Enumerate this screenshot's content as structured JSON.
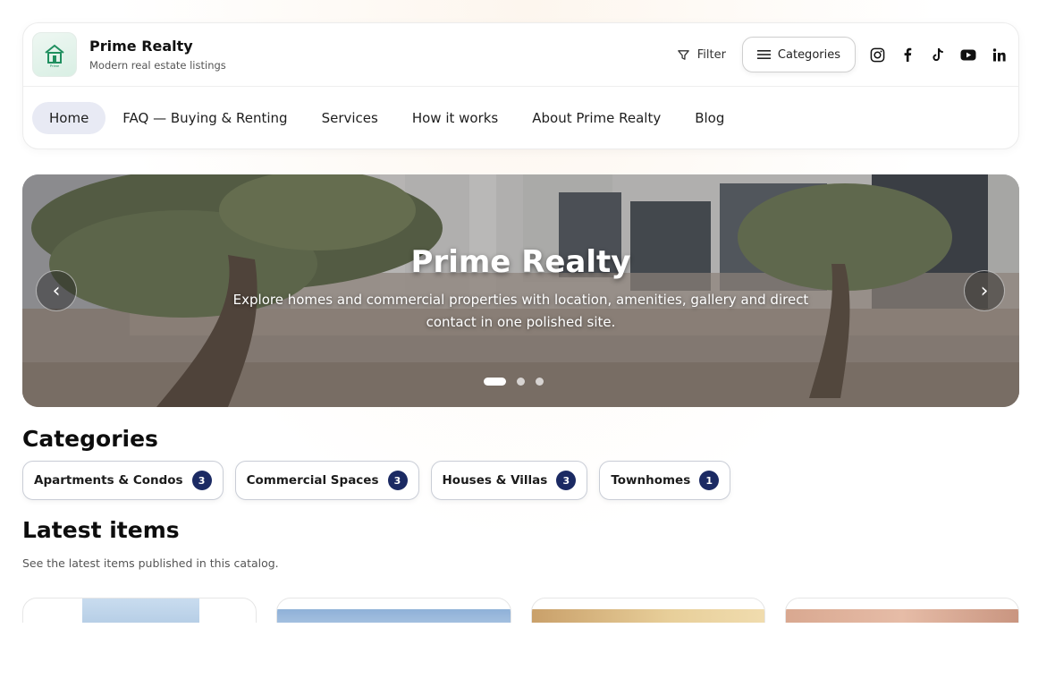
{
  "brand": {
    "name": "Prime Realty",
    "tagline": "Modern real estate listings",
    "logo_text": "Prime"
  },
  "toolbar": {
    "filter_label": "Filter",
    "categories_label": "Categories",
    "socials": [
      "instagram-icon",
      "facebook-icon",
      "tiktok-icon",
      "youtube-icon",
      "linkedin-icon"
    ]
  },
  "nav": {
    "items": [
      {
        "label": "Home",
        "active": true
      },
      {
        "label": "FAQ — Buying & Renting"
      },
      {
        "label": "Services"
      },
      {
        "label": "How it works"
      },
      {
        "label": "About Prime Realty"
      },
      {
        "label": "Blog"
      }
    ]
  },
  "hero": {
    "title": "Prime Realty",
    "subtitle": "Explore homes and commercial properties with location, amenities, gallery and direct contact in one polished site.",
    "prev_glyph": "‹",
    "next_glyph": "›",
    "slides": 3,
    "active_slide": 1
  },
  "categories": {
    "title": "Categories",
    "items": [
      {
        "label": "Apartments & Condos",
        "count": "3"
      },
      {
        "label": "Commercial Spaces",
        "count": "3"
      },
      {
        "label": "Houses & Villas",
        "count": "3"
      },
      {
        "label": "Townhomes",
        "count": "1"
      }
    ]
  },
  "latest": {
    "title": "Latest items",
    "subtitle": "See the latest items published in this catalog."
  },
  "colors": {
    "accent": "#1b2a63",
    "nav_active_bg": "#e8eaf4"
  }
}
